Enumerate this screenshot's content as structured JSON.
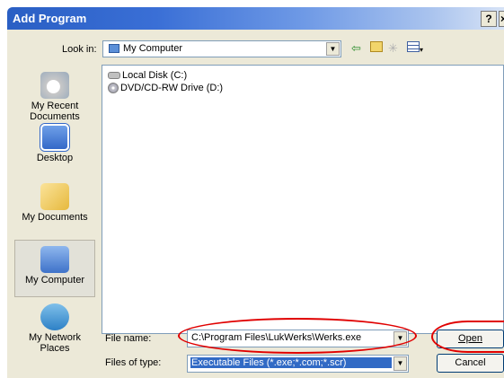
{
  "window": {
    "title": "Add Program",
    "help_button": "?",
    "close_button": "×"
  },
  "look_in": {
    "label": "Look in:",
    "value": "My Computer"
  },
  "toolbar": [
    "back-icon",
    "up-folder-icon",
    "new-folder-icon",
    "views-menu-icon"
  ],
  "places": [
    {
      "label": "My Recent Documents",
      "icon": "recent-documents-icon"
    },
    {
      "label": "Desktop",
      "icon": "desktop-icon"
    },
    {
      "label": "My Documents",
      "icon": "my-documents-icon"
    },
    {
      "label": "My Computer",
      "icon": "my-computer-icon",
      "selected": true
    },
    {
      "label": "My Network Places",
      "icon": "network-places-icon"
    }
  ],
  "files": [
    {
      "name": "Local Disk (C:)",
      "icon": "local-disk-icon"
    },
    {
      "name": "DVD/CD-RW Drive (D:)",
      "icon": "dvd-drive-icon"
    }
  ],
  "file_name": {
    "label": "File name:",
    "value": "C:\\Program Files\\LukWerks\\Werks.exe"
  },
  "file_type": {
    "label": "Files of type:",
    "value": "Executable Files (*.exe;*.com;*.scr)"
  },
  "buttons": {
    "open": "Open",
    "cancel": "Cancel"
  },
  "colors": {
    "titlebar": "#2a5fc4",
    "dialog": "#ece9d8",
    "highlight": "#316ac5",
    "annotation": "#e00000"
  }
}
